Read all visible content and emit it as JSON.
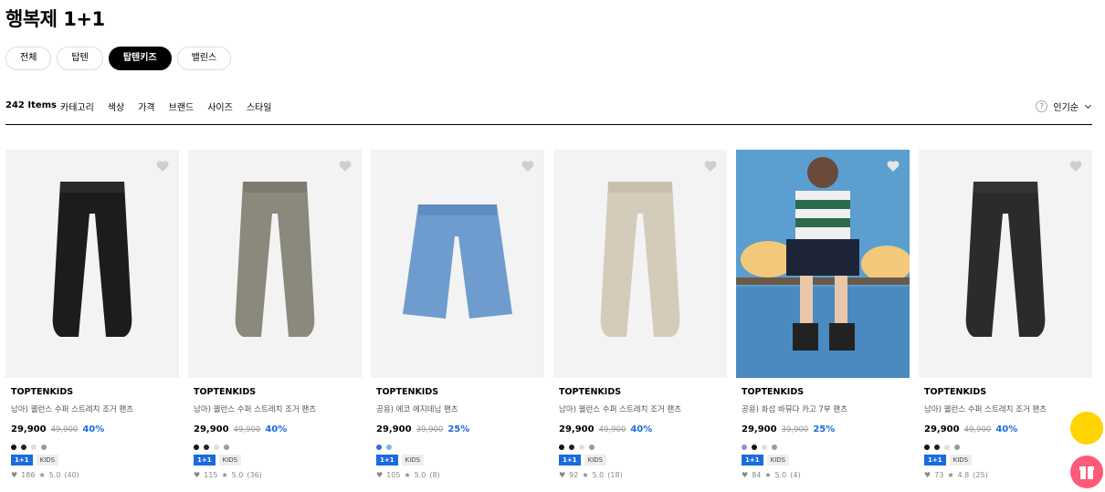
{
  "page": {
    "title": "행복제 1+1"
  },
  "tabs": [
    {
      "label": "전체",
      "active": false
    },
    {
      "label": "탑텐",
      "active": false
    },
    {
      "label": "탑텐키즈",
      "active": true
    },
    {
      "label": "밸린스",
      "active": false
    }
  ],
  "filterbar": {
    "count": "242 Items",
    "filters": [
      "카테고리",
      "색상",
      "가격",
      "브랜드",
      "사이즈",
      "스타일"
    ],
    "help": "?",
    "sort": "인기순"
  },
  "products": [
    {
      "brand": "TOPTENKIDS",
      "name": "남아) 웰런스 수퍼 스트레치 조거 팬츠",
      "price": "29,900",
      "original": "49,900",
      "discount": "40%",
      "swatches": [
        "#111111",
        "#222222",
        "#e8e0c8",
        "#9a9a9a"
      ],
      "badges": [
        "1+1",
        "KIDS"
      ],
      "likes": "186",
      "rating": "5.0",
      "reviews": "(40)",
      "image": "black-jogger"
    },
    {
      "brand": "TOPTENKIDS",
      "name": "남아) 웰런스 수퍼 스트레치 조거 팬츠",
      "price": "29,900",
      "original": "49,900",
      "discount": "40%",
      "swatches": [
        "#111111",
        "#222222",
        "#e8e0c8",
        "#9a9a9a"
      ],
      "badges": [
        "1+1",
        "KIDS"
      ],
      "likes": "115",
      "rating": "5.0",
      "reviews": "(36)",
      "image": "gray-jogger"
    },
    {
      "brand": "TOPTENKIDS",
      "name": "공용) 에코 에지데님 팬츠",
      "price": "29,900",
      "original": "39,900",
      "discount": "25%",
      "swatches": [
        "#2f6fd0",
        "#7fb5e8"
      ],
      "badges": [
        "1+1",
        "KIDS"
      ],
      "likes": "105",
      "rating": "5.0",
      "reviews": "(8)",
      "image": "denim-pants"
    },
    {
      "brand": "TOPTENKIDS",
      "name": "남아) 웰런스 수퍼 스트레치 조거 팬츠",
      "price": "29,900",
      "original": "49,900",
      "discount": "40%",
      "swatches": [
        "#111111",
        "#222222",
        "#e8e0c8",
        "#9a9a9a"
      ],
      "badges": [
        "1+1",
        "KIDS"
      ],
      "likes": "92",
      "rating": "5.0",
      "reviews": "(18)",
      "image": "beige-jogger"
    },
    {
      "brand": "TOPTENKIDS",
      "name": "공용) 화섬 바뮤다 카고 7부 팬츠",
      "price": "29,900",
      "original": "39,900",
      "discount": "25%",
      "swatches": [
        "#9a8ad0",
        "#111111",
        "#e8e0c8",
        "#9a9a9a"
      ],
      "badges": [
        "1+1",
        "KIDS"
      ],
      "likes": "84",
      "rating": "5.0",
      "reviews": "(4)",
      "image": "model-photo"
    },
    {
      "brand": "TOPTENKIDS",
      "name": "남아) 웰런스 수퍼 스트레치 조거 팬츠",
      "price": "29,900",
      "original": "49,900",
      "discount": "40%",
      "swatches": [
        "#111111",
        "#222222",
        "#e8e0c8",
        "#9a9a9a"
      ],
      "badges": [
        "1+1",
        "KIDS"
      ],
      "likes": "73",
      "rating": "4.8",
      "reviews": "(25)",
      "image": "charcoal-jogger"
    }
  ],
  "floating": {
    "left_icon": "coupon-icon",
    "right_icon": "gift-icon"
  }
}
